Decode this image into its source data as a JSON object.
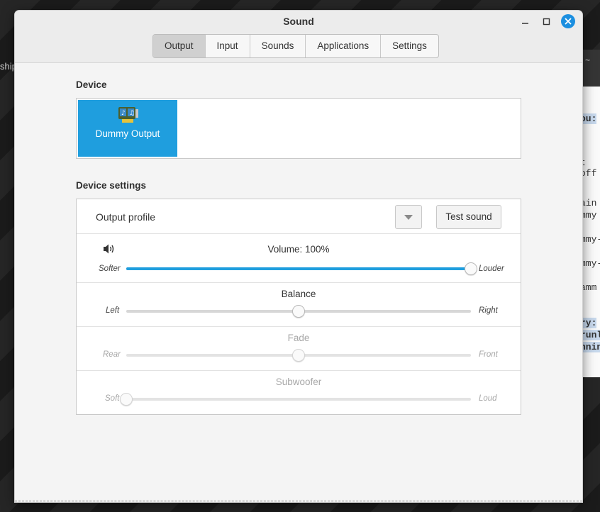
{
  "background": {
    "left_fragment": "ship",
    "terminal_head_glyph": "~",
    "terminal_lines": [
      {
        "text": "ou:",
        "highlight": true
      },
      {
        "text": "t",
        "highlight": false
      },
      {
        "text": "off",
        "highlight": false
      },
      {
        "text": "ain",
        "highlight": false
      },
      {
        "text": "mmy",
        "highlight": false
      },
      {
        "text": "mmy-",
        "highlight": false
      },
      {
        "text": "mmy-",
        "highlight": false
      },
      {
        "text": "amm",
        "highlight": false
      },
      {
        "text": "ry:",
        "highlight": true
      },
      {
        "text": "runl",
        "highlight": true
      },
      {
        "text": "nnin",
        "highlight": true
      }
    ]
  },
  "window": {
    "title": "Sound",
    "controls": [
      "minimize-icon",
      "maximize-icon",
      "close-icon"
    ],
    "accent_color": "#1f9ede"
  },
  "tabs": [
    {
      "label": "Output",
      "active": true
    },
    {
      "label": "Input",
      "active": false
    },
    {
      "label": "Sounds",
      "active": false
    },
    {
      "label": "Applications",
      "active": false
    },
    {
      "label": "Settings",
      "active": false
    }
  ],
  "device": {
    "section_label": "Device",
    "items": [
      {
        "label": "Dummy Output",
        "icon": "sound-card-icon",
        "selected": true
      }
    ]
  },
  "device_settings": {
    "section_label": "Device settings",
    "profile_label": "Output profile",
    "test_button": "Test sound",
    "volume": {
      "title": "Volume: 100%",
      "left": "Softer",
      "right": "Louder",
      "value": 1.0,
      "icon": "speaker-icon"
    },
    "balance": {
      "title": "Balance",
      "left": "Left",
      "right": "Right",
      "value": 0.5
    },
    "fade": {
      "title": "Fade",
      "left": "Rear",
      "right": "Front",
      "value": 0.5,
      "disabled": true
    },
    "subwoofer": {
      "title": "Subwoofer",
      "left": "Soft",
      "right": "Loud",
      "value": 0.0,
      "disabled": true
    }
  }
}
